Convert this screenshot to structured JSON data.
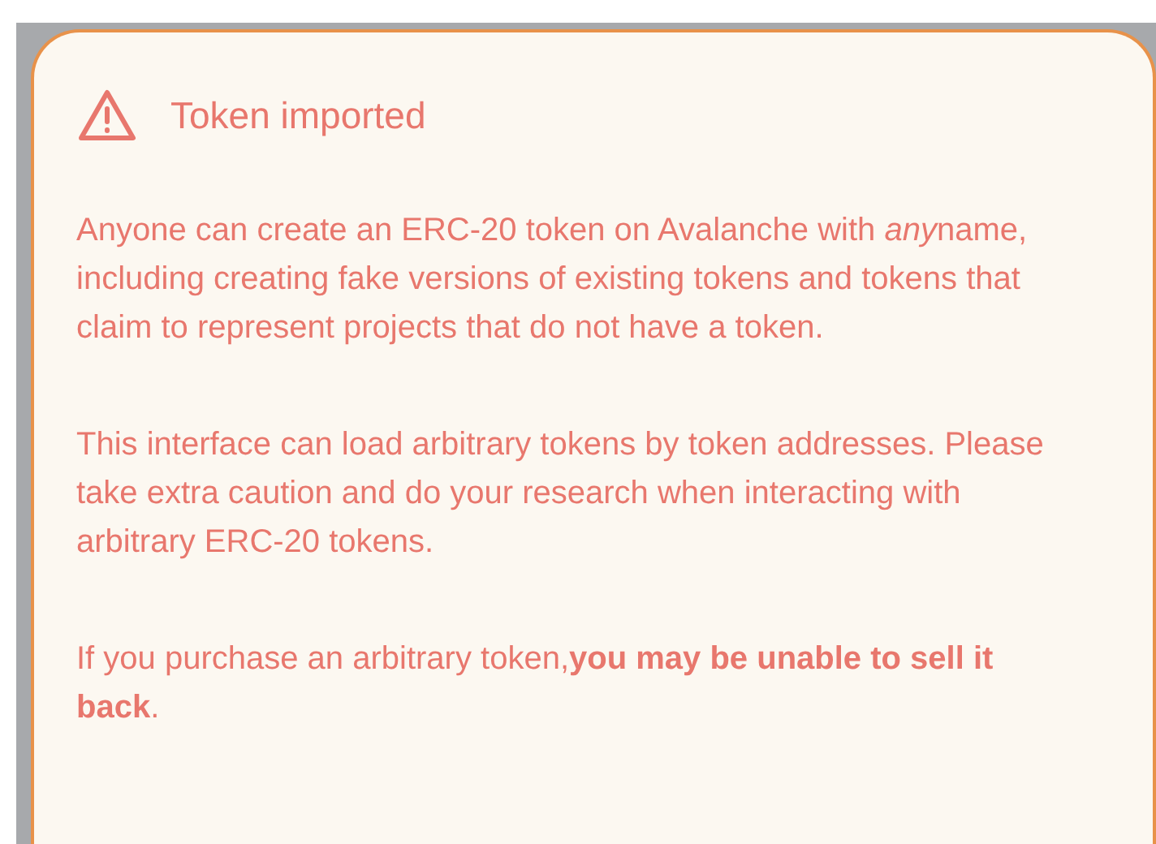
{
  "dialog": {
    "title": "Token imported",
    "paragraphs": [
      [
        {
          "kind": "plain",
          "text": "Anyone can create an ERC-20 token on Avalanche with "
        },
        {
          "kind": "italic",
          "text": "any"
        },
        {
          "kind": "plain",
          "text": "name, including creating fake versions of existing tokens and tokens that claim to represent projects that do not have a token."
        }
      ],
      [
        {
          "kind": "plain",
          "text": "This interface can load arbitrary tokens by token addresses. Please take extra caution and do your research when interacting with arbitrary ERC-20 tokens."
        }
      ],
      [
        {
          "kind": "plain",
          "text": "If you purchase an arbitrary token,"
        },
        {
          "kind": "bold",
          "text": "you may be unable to sell it back"
        },
        {
          "kind": "plain",
          "text": "."
        }
      ]
    ]
  }
}
